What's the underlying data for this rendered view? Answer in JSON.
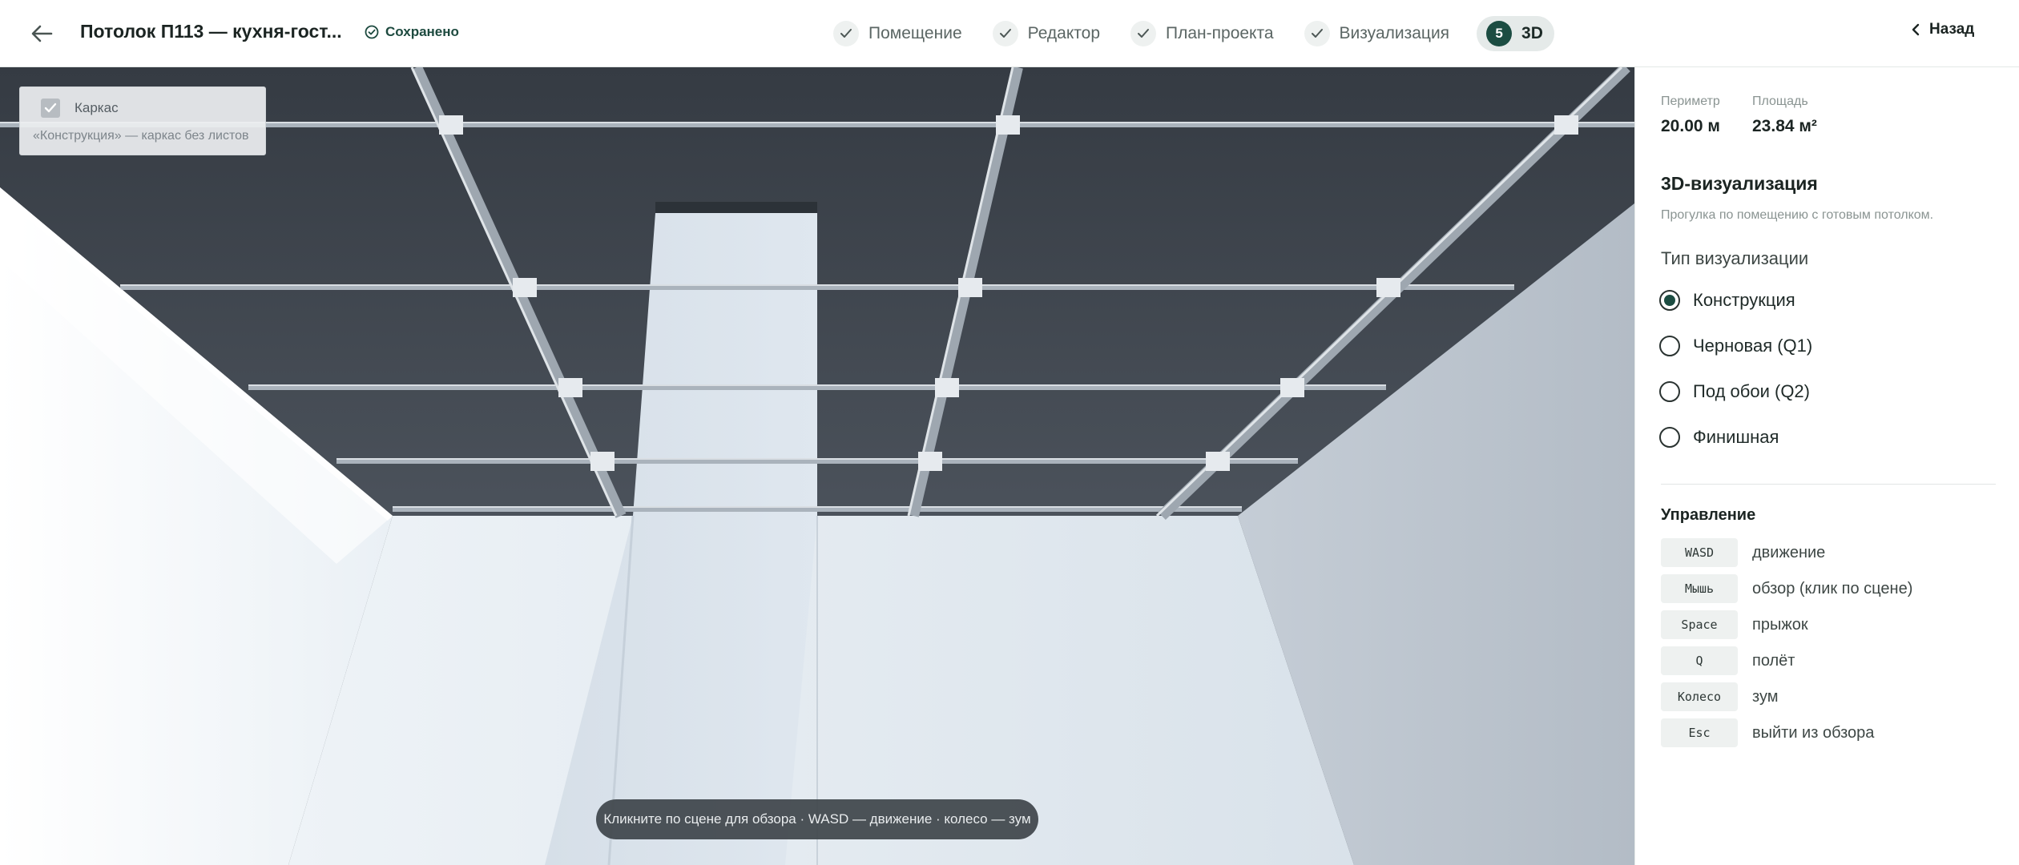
{
  "header": {
    "project_title": "Потолок П113 — кухня-гост...",
    "saved_label": "Сохранено",
    "steps": [
      {
        "label": "Помещение",
        "done": true
      },
      {
        "label": "Редактор",
        "done": true
      },
      {
        "label": "План-проекта",
        "done": true
      },
      {
        "label": "Визуализация",
        "done": true
      },
      {
        "number": "5",
        "label": "3D",
        "active": true
      }
    ],
    "back_label": "Назад"
  },
  "viewport": {
    "layer": {
      "label": "Каркас",
      "checked": true,
      "subtitle": "«Конструкция» — каркас без листов"
    },
    "hint": "Кликните по сцене для обзора · WASD — движение · колесо — зум"
  },
  "panel": {
    "perimeter": {
      "caption": "Периметр",
      "value": "20.00 м"
    },
    "area": {
      "caption": "Площадь",
      "value": "23.84 м²"
    },
    "title": "3D-визуализация",
    "description": "Прогулка по помещению с готовым потолком.",
    "viz_type_label": "Тип визуализации",
    "viz_options": [
      {
        "label": "Конструкция",
        "selected": true
      },
      {
        "label": "Черновая (Q1)",
        "selected": false
      },
      {
        "label": "Под обои (Q2)",
        "selected": false
      },
      {
        "label": "Финишная",
        "selected": false
      }
    ],
    "controls_title": "Управление",
    "controls": [
      {
        "key": "WASD",
        "desc": "движение"
      },
      {
        "key": "Мышь",
        "desc": "обзор (клик по сцене)"
      },
      {
        "key": "Space",
        "desc": "прыжок"
      },
      {
        "key": "Q",
        "desc": "полёт"
      },
      {
        "key": "Колесо",
        "desc": "зум"
      },
      {
        "key": "Esc",
        "desc": "выйти из обзора"
      }
    ]
  },
  "colors": {
    "accent": "#1c4d42",
    "ceiling": "#3c434b",
    "wall": "#dde5ec"
  }
}
